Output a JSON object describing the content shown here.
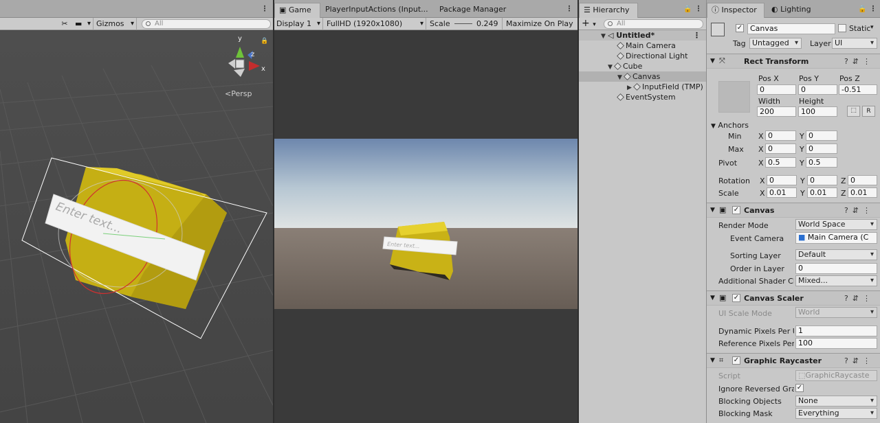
{
  "scene": {
    "toolbar": {
      "gizmos_label": "Gizmos",
      "search_placeholder": "All"
    },
    "persp_label": "Persp",
    "axis_labels": {
      "y": "y",
      "z": "z",
      "x": "x"
    },
    "input_placeholder": "Enter text..."
  },
  "game": {
    "tabs": [
      "Game",
      "PlayerInputActions (Input...",
      "Package Manager"
    ],
    "display": "Display 1",
    "resolution": "FullHD (1920x1080)",
    "scale_label": "Scale",
    "scale_value": "0.249",
    "maximize": "Maximize On Play",
    "input_placeholder": "Enter text..."
  },
  "hierarchy": {
    "tab": "Hierarchy",
    "search_placeholder": "All",
    "scene_name": "Untitled*",
    "items": [
      "Main Camera",
      "Directional Light",
      "Cube",
      "Canvas",
      "InputField (TMP)",
      "EventSystem"
    ]
  },
  "inspector": {
    "tabs": [
      "Inspector",
      "Lighting"
    ],
    "object_name": "Canvas",
    "static_label": "Static",
    "tag_label": "Tag",
    "tag_value": "Untagged",
    "layer_label": "Layer",
    "layer_value": "UI",
    "rect": {
      "title": "Rect Transform",
      "pos_headers": [
        "Pos X",
        "Pos Y",
        "Pos Z"
      ],
      "pos_values": [
        "0",
        "0",
        "-0.51"
      ],
      "size_headers": [
        "Width",
        "Height"
      ],
      "size_values": [
        "200",
        "100"
      ],
      "r_button": "R",
      "anchors": "Anchors",
      "min_label": "Min",
      "max_label": "Max",
      "min": [
        "0",
        "0"
      ],
      "max": [
        "0",
        "0"
      ],
      "pivot_label": "Pivot",
      "pivot": [
        "0.5",
        "0.5"
      ],
      "rotation_label": "Rotation",
      "rotation": [
        "0",
        "0",
        "0"
      ],
      "scale_label": "Scale",
      "scale": [
        "0.01",
        "0.01",
        "0.01"
      ],
      "axis": [
        "X",
        "Y",
        "Z"
      ]
    },
    "canvas": {
      "title": "Canvas",
      "render_mode_label": "Render Mode",
      "render_mode": "World Space",
      "event_camera_label": "Event Camera",
      "event_camera": "Main Camera (C",
      "sorting_layer_label": "Sorting Layer",
      "sorting_layer": "Default",
      "order_label": "Order in Layer",
      "order": "0",
      "shader_label": "Additional Shader Ch",
      "shader": "Mixed..."
    },
    "scaler": {
      "title": "Canvas Scaler",
      "mode_label": "UI Scale Mode",
      "mode": "World",
      "dpu_label": "Dynamic Pixels Per U",
      "dpu": "1",
      "rpu_label": "Reference Pixels Per",
      "rpu": "100"
    },
    "raycaster": {
      "title": "Graphic Raycaster",
      "script_label": "Script",
      "script": "GraphicRaycaste",
      "ignore_label": "Ignore Reversed Grap",
      "blocking_obj_label": "Blocking Objects",
      "blocking_obj": "None",
      "blocking_mask_label": "Blocking Mask",
      "blocking_mask": "Everything"
    }
  },
  "colors": {
    "cube": "#d8c21a",
    "sky_top": "#6d87ad",
    "ground": "#6c625a",
    "scene_bg": "#474747"
  }
}
